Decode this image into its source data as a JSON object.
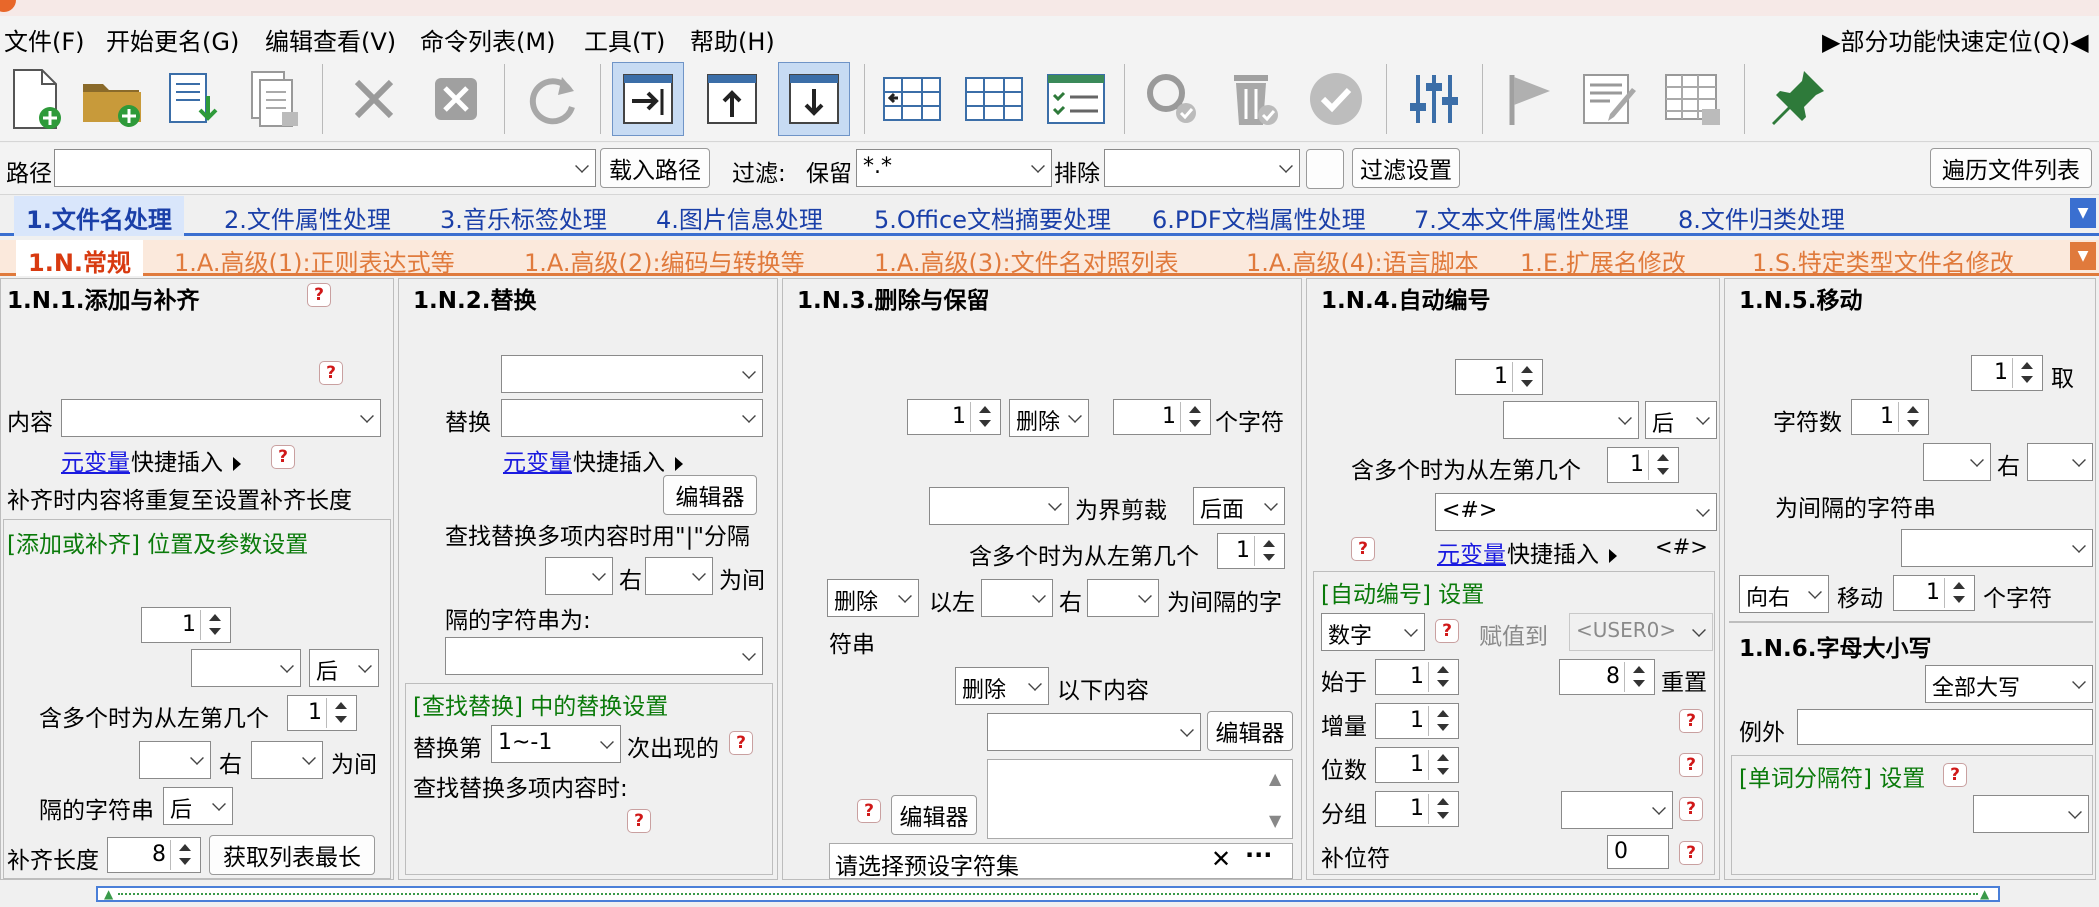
{
  "menu": {
    "items": [
      "文件(F)",
      "开始更名(G)",
      "编辑查看(V)",
      "命令列表(M)",
      "工具(T)",
      "帮助(H)"
    ],
    "quick_locate": "▶部分功能快速定位(Q)◀"
  },
  "toolbar": {
    "icons": [
      "new-file-icon",
      "add-folder-icon",
      "import-list-icon",
      "export-list-icon",
      "delete-icon",
      "clear-icon",
      "refresh-icon",
      "move-to-end-icon",
      "move-up-icon",
      "move-down-icon",
      "column-layout-icon",
      "grid-icon",
      "checklist-icon",
      "search-icon",
      "trash-check-icon",
      "confirm-icon",
      "settings-sliders-icon",
      "flag-icon",
      "edit-icon",
      "table-view-icon",
      "pin-icon"
    ]
  },
  "pathbar": {
    "path_label": "路径",
    "path_value": "",
    "load_path": "载入路径",
    "filter_label": "过滤:",
    "keep_label": "保留",
    "keep_value": "*.*",
    "exclude_label": "排除",
    "exclude_value": "",
    "filter_settings": "过滤设置",
    "traverse_list": "遍历文件列表"
  },
  "tabs_main": [
    "1.文件名处理",
    "2.文件属性处理",
    "3.音乐标签处理",
    "4.图片信息处理",
    "5.Office文档摘要处理",
    "6.PDF文档属性处理",
    "7.文本文件属性处理",
    "8.文件归类处理"
  ],
  "tabs_sub": [
    "1.N.常规",
    "1.A.高级(1):正则表达式等",
    "1.A.高级(2):编码与转换等",
    "1.A.高级(3):文件名对照列表",
    "1.A.高级(4):语言脚本",
    "1.E.扩展名修改",
    "1.S.特定类型文件名修改"
  ],
  "p1": {
    "title": "1.N.1.添加与补齐",
    "content_label": "内容",
    "content_value": "",
    "var_link": "元变量",
    "quick_insert": "快捷插入",
    "pad_note": "补齐时内容将重复至设置补齐长度",
    "section": "[添加或补齐] 位置及参数设置",
    "pos_num": "1",
    "after": "后",
    "multi_left": "含多个时为从左第几个",
    "multi_num": "1",
    "right": "右",
    "between": "为间",
    "sep_str": "隔的字符串",
    "sep_after": "后",
    "pad_len_label": "补齐长度",
    "pad_len": "8",
    "get_max": "获取列表最长"
  },
  "p2": {
    "title": "1.N.2.替换",
    "replace_label": "替换",
    "var_link": "元变量",
    "quick_insert": "快捷插入",
    "editor": "编辑器",
    "multi_note": "查找替换多项内容时用\"|\"分隔",
    "right": "右",
    "between": "为间",
    "sep_str_for": "隔的字符串为:",
    "section": "[查找替换] 中的替换设置",
    "replace_nth": "替换第",
    "nth_value": "1~-1",
    "occur": "次出现的",
    "multi_find": "查找替换多项内容时:"
  },
  "p3": {
    "title": "1.N.3.删除与保留",
    "num1": "1",
    "delete": "删除",
    "num2": "1",
    "chars": "个字符",
    "boundary_cut": "为界剪裁",
    "behind": "后面",
    "multi_left": "含多个时为从左第几个",
    "multi_num": "1",
    "delete2": "删除",
    "left_of": "以左",
    "right": "右",
    "sep_str": "为间隔的字",
    "sep_str2": "符串",
    "delete3": "删除",
    "following": "以下内容",
    "editor1": "编辑器",
    "editor2": "编辑器",
    "preset": "请选择预设字符集"
  },
  "p4": {
    "title": "1.N.4.自动编号",
    "num1": "1",
    "after": "后",
    "multi_left": "含多个时为从左第几个",
    "multi_num": "1",
    "token": "<#>",
    "var_link": "元变量",
    "quick_insert": "快捷插入",
    "token_small": "<#>",
    "section": "[自动编号] 设置",
    "type": "数字",
    "assign_to": "赋值到",
    "user_var": "<USER0>",
    "start_label": "始于",
    "start": "1",
    "reset_num": "8",
    "reset": "重置",
    "increment_label": "增量",
    "increment": "1",
    "digits_label": "位数",
    "digits": "1",
    "group_label": "分组",
    "group": "1",
    "pad_char_label": "补位符",
    "pad_char": "0"
  },
  "p5": {
    "title": "1.N.5.移动",
    "num1": "1",
    "take": "取",
    "char_count_label": "字符数",
    "char_count": "1",
    "right": "右",
    "sep_str": "为间隔的字符串",
    "dir": "向右",
    "move": "移动",
    "move_num": "1",
    "chars": "个字符",
    "title6": "1.N.6.字母大小写",
    "case_value": "全部大写",
    "except_label": "例外",
    "word_sep": "[单词分隔符] 设置"
  }
}
